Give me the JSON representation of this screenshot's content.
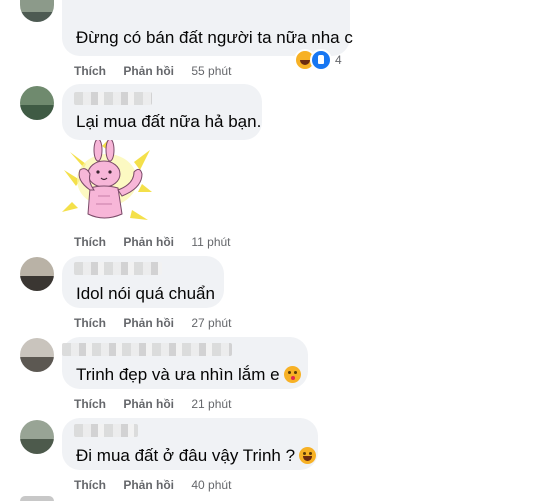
{
  "comments": [
    {
      "text": "Đừng có bán đất người ta nữa nha c",
      "like": "Thích",
      "reply": "Phản hồi",
      "time": "55 phút",
      "reactions": {
        "icons": [
          "haha-icon",
          "like-icon"
        ],
        "count": "4"
      }
    },
    {
      "text": "Lại mua đất nữa hả bạn.",
      "sticker": "pink-bunny-muscle-sticker",
      "like": "Thích",
      "reply": "Phản hồi",
      "time": "11 phút"
    },
    {
      "text": "Idol nói quá chuẩn",
      "like": "Thích",
      "reply": "Phản hồi",
      "time": "27 phút"
    },
    {
      "text": "Trinh đẹp và ưa nhìn lắm e",
      "emoji": "kiss-face-icon",
      "like": "Thích",
      "reply": "Phản hồi",
      "time": "21 phút"
    },
    {
      "text": "Đi mua đất ở đâu vậy Trinh ?",
      "emoji": "laughing-face-icon",
      "like": "Thích",
      "reply": "Phản hồi",
      "time": "40 phút"
    }
  ],
  "colors": {
    "bubble": "#f0f2f5",
    "meta_text": "#65676b",
    "like_reaction": "#1877f2",
    "haha_reaction": "#f7b125"
  }
}
